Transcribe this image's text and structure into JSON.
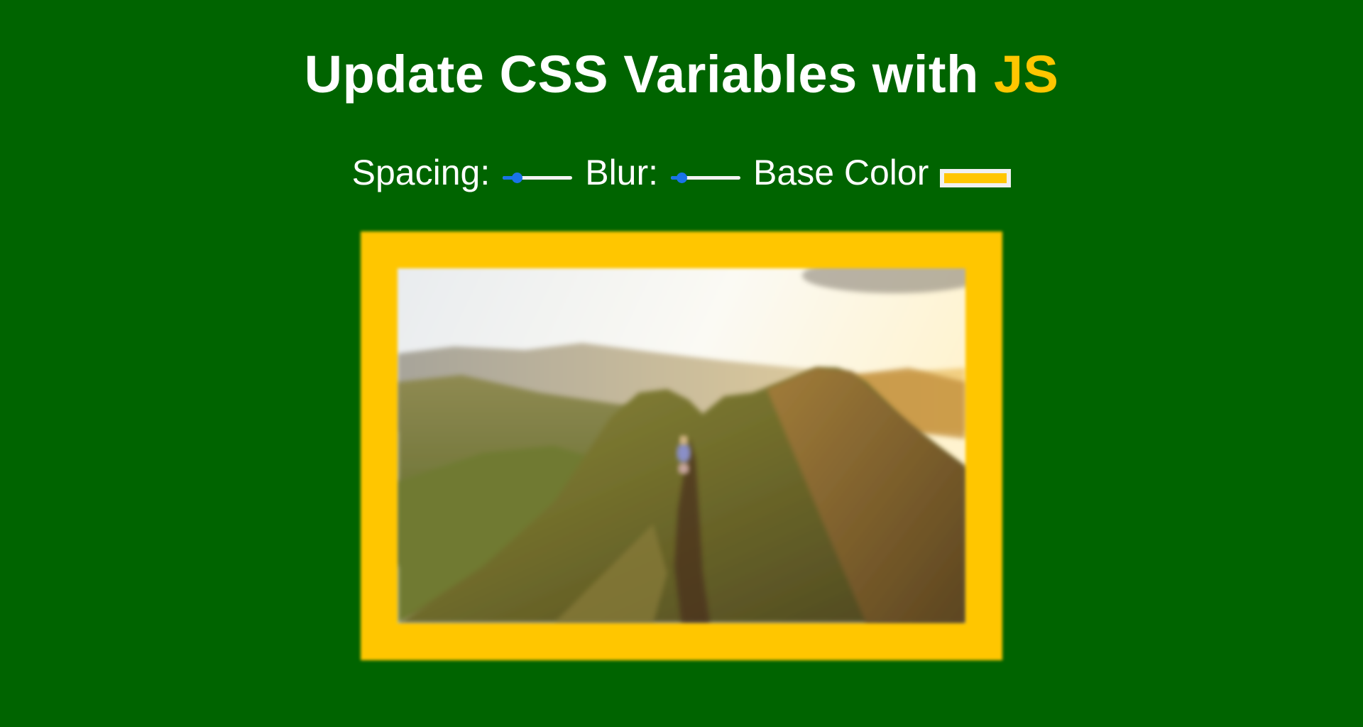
{
  "header": {
    "title_main": "Update CSS Variables with ",
    "title_highlight": "JS"
  },
  "controls": {
    "spacing_label": "Spacing:",
    "spacing_value": 0.2,
    "blur_label": "Blur:",
    "blur_value": 0.15,
    "base_color_label": "Base Color",
    "base_color_value": "#ffc600"
  },
  "colors": {
    "background": "#006400",
    "accent": "#ffc600",
    "slider": "#1a73e8"
  },
  "image": {
    "description_icon": "mountain-ridge-photo-icon"
  }
}
